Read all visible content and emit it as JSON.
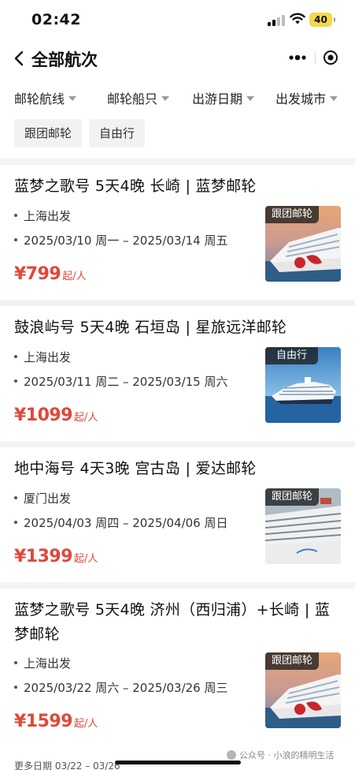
{
  "status_bar": {
    "time": "02:42",
    "battery": "40"
  },
  "nav": {
    "title": "全部航次"
  },
  "filters": [
    {
      "label": "邮轮航线"
    },
    {
      "label": "邮轮船只"
    },
    {
      "label": "出游日期"
    },
    {
      "label": "出发城市"
    }
  ],
  "chips": [
    {
      "label": "跟团邮轮"
    },
    {
      "label": "自由行"
    }
  ],
  "cruises": [
    {
      "title": "蓝梦之歌号 5天4晚 长崎 | 蓝梦邮轮",
      "departure": "上海出发",
      "dates": "2025/03/10 周一 – 2025/03/14 周五",
      "price": "¥799",
      "price_suffix": "起/人",
      "badge": "跟团邮轮"
    },
    {
      "title": "鼓浪屿号 5天4晚 石垣岛 | 星旅远洋邮轮",
      "departure": "上海出发",
      "dates": "2025/03/11 周二 – 2025/03/15 周六",
      "price": "¥1099",
      "price_suffix": "起/人",
      "badge": "自由行"
    },
    {
      "title": "地中海号 4天3晚 宫古岛 | 爱达邮轮",
      "departure": "厦门出发",
      "dates": "2025/04/03 周四 – 2025/04/06 周日",
      "price": "¥1399",
      "price_suffix": "起/人",
      "badge": "跟团邮轮"
    },
    {
      "title": "蓝梦之歌号 5天4晚 济州（西归浦）+长崎 | 蓝梦邮轮",
      "departure": "上海出发",
      "dates": "2025/03/22 周六 – 2025/03/26 周三",
      "price": "¥1599",
      "price_suffix": "起/人",
      "badge": "跟团邮轮"
    }
  ],
  "bottom_hint": "更多日期 03/22 – 03/26",
  "watermark": "公众号 · 小浪的精明生活"
}
